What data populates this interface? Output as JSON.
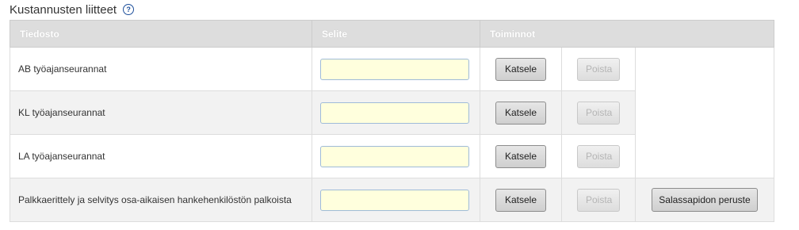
{
  "section": {
    "title": "Kustannusten liitteet",
    "help_icon": "question-circle-icon"
  },
  "table": {
    "headers": {
      "file": "Tiedosto",
      "description": "Selite",
      "actions": "Toiminnot"
    },
    "rows": [
      {
        "file": "AB työajanseurannat",
        "description_value": "",
        "view_label": "Katsele",
        "delete_label": "Poista",
        "delete_enabled": false,
        "secrecy_label": ""
      },
      {
        "file": "KL työajanseurannat",
        "description_value": "",
        "view_label": "Katsele",
        "delete_label": "Poista",
        "delete_enabled": false,
        "secrecy_label": ""
      },
      {
        "file": "LA työajanseurannat",
        "description_value": "",
        "view_label": "Katsele",
        "delete_label": "Poista",
        "delete_enabled": false,
        "secrecy_label": ""
      },
      {
        "file": "Palkkaerittely ja selvitys osa-aikaisen hankehenkilöstön palkoista",
        "description_value": "",
        "view_label": "Katsele",
        "delete_label": "Poista",
        "delete_enabled": false,
        "secrecy_label": "Salassapidon peruste"
      }
    ]
  },
  "colors": {
    "header_bg": "#dddddd",
    "input_bg": "#ffffdd",
    "help_icon": "#1d4f9b",
    "row_alt_bg": "#f2f2f2"
  }
}
